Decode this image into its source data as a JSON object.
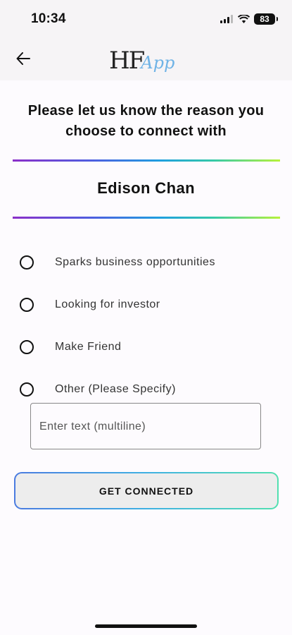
{
  "status_bar": {
    "time": "10:34",
    "battery": "83",
    "icons": [
      "signal-icon",
      "wifi-icon",
      "battery-icon"
    ]
  },
  "header": {
    "back_icon": "arrow-left-icon",
    "logo_main": "HF",
    "logo_sub": "App"
  },
  "prompt": {
    "question": "Please let us know the reason you choose to connect with",
    "name": "Edison Chan"
  },
  "options": [
    {
      "label": "Sparks business opportunities",
      "selected": false
    },
    {
      "label": "Looking for investor",
      "selected": false
    },
    {
      "label": "Make Friend",
      "selected": false
    },
    {
      "label": "Other (Please Specify)",
      "selected": false
    }
  ],
  "other_input": {
    "placeholder": "Enter text (multiline)",
    "value": ""
  },
  "actions": {
    "connect_label": "GET CONNECTED"
  },
  "colors": {
    "gradient_start": "#8b2fc9",
    "gradient_mid": "#1f9fe0",
    "gradient_end": "#b7f23a",
    "button_bg": "#ededed"
  }
}
